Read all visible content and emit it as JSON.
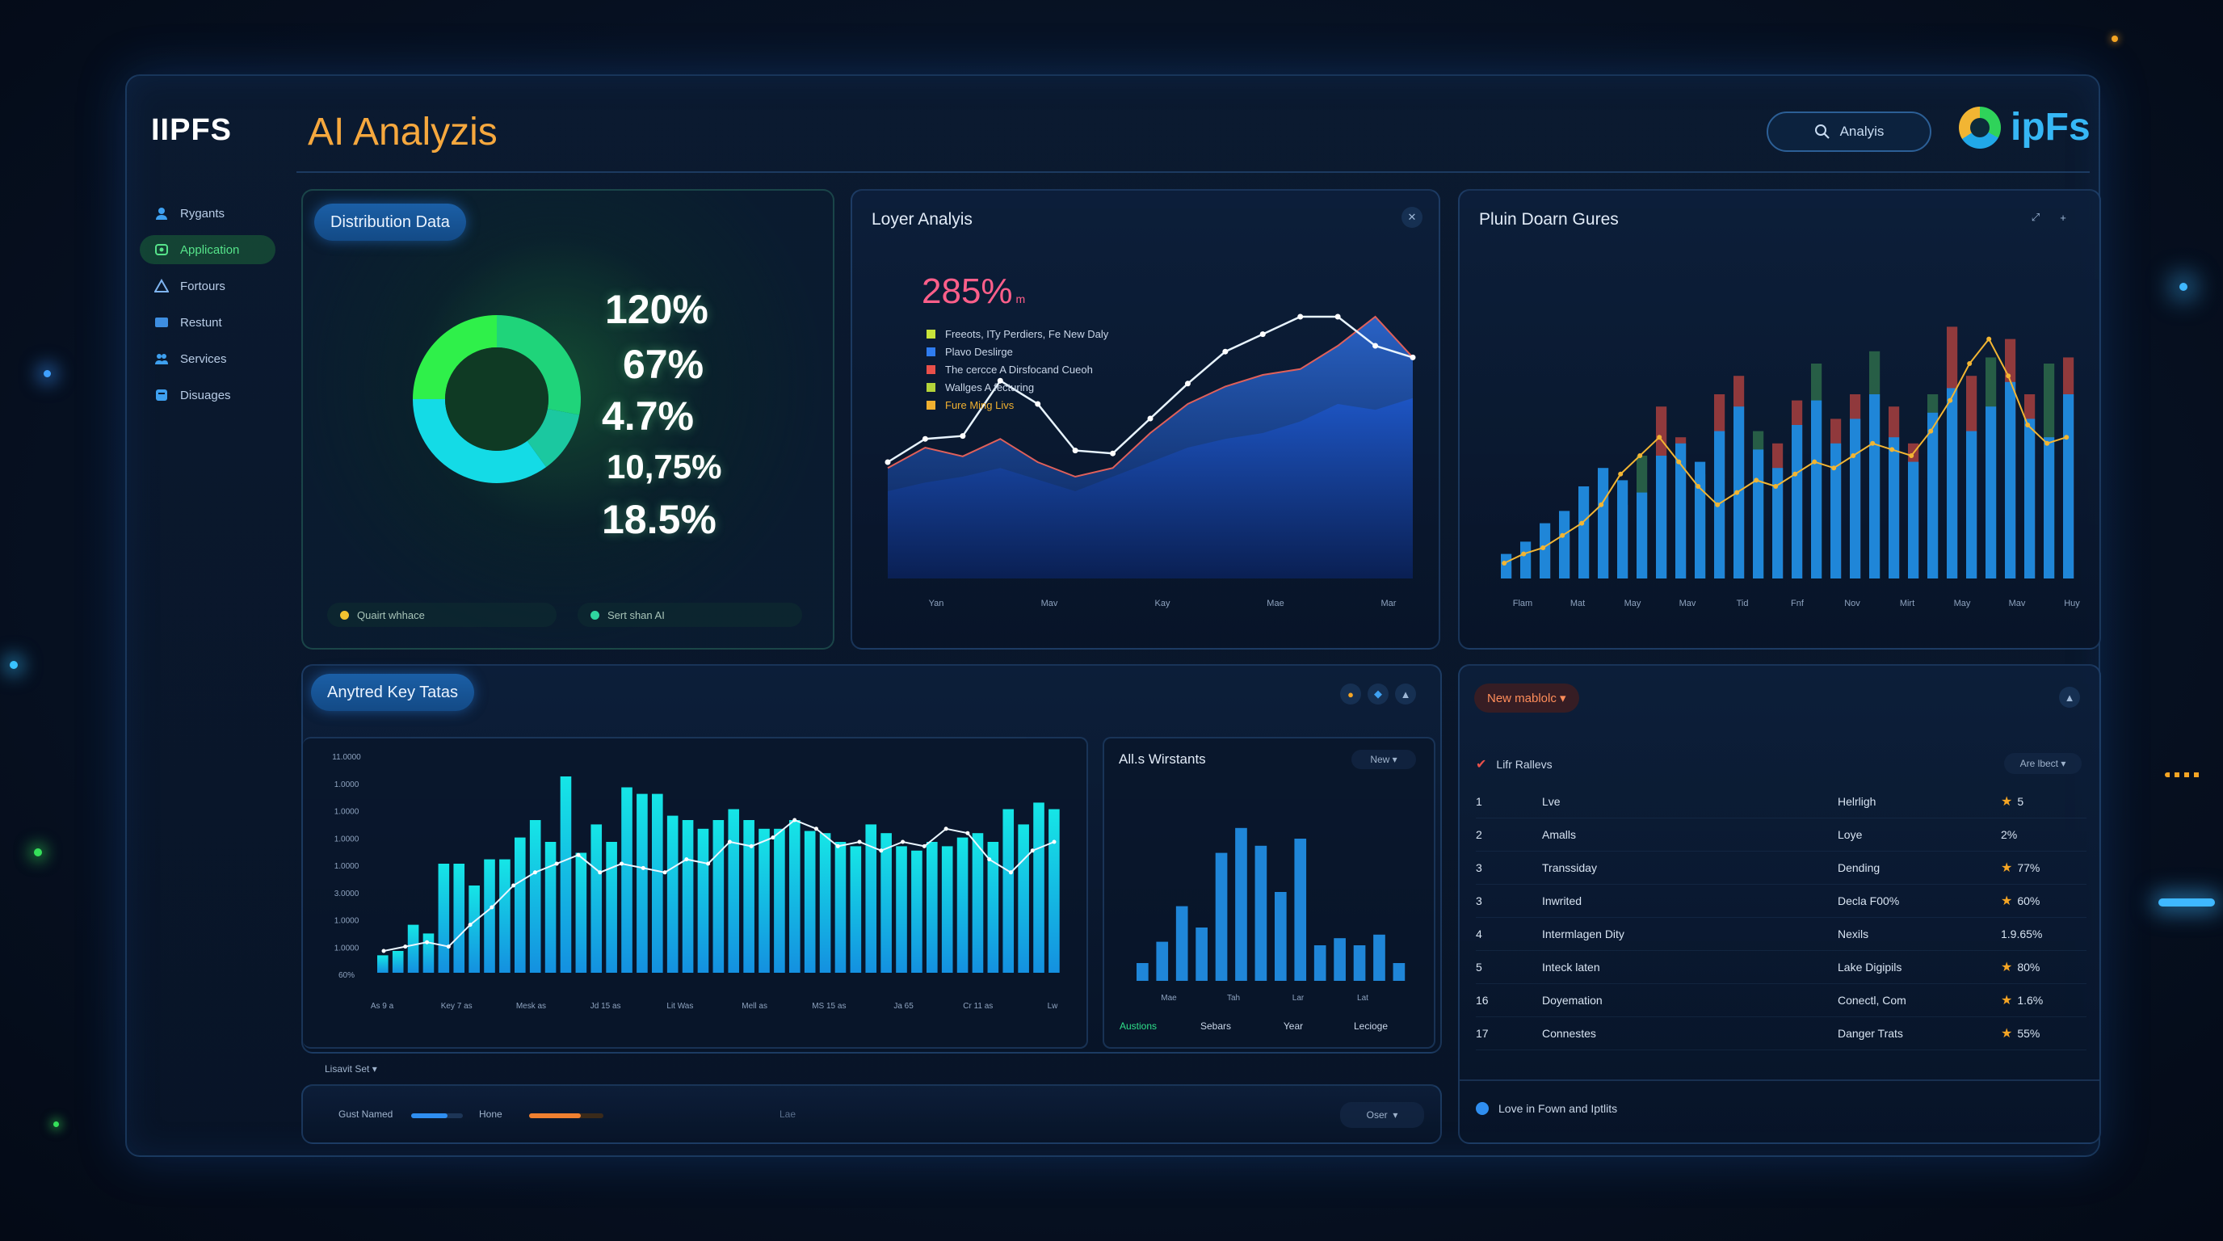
{
  "header": {
    "brand": "IIPFS",
    "title": "AI Analyzis",
    "search_label": "Analyis",
    "logo_text": "ipFs"
  },
  "sidebar": {
    "items": [
      {
        "label": "Rygants",
        "icon": "user-icon",
        "active": false
      },
      {
        "label": "Application",
        "icon": "app-icon",
        "active": true
      },
      {
        "label": "Fortours",
        "icon": "triangle-icon",
        "active": false
      },
      {
        "label": "Restunt",
        "icon": "card-icon",
        "active": false
      },
      {
        "label": "Services",
        "icon": "users-icon",
        "active": false
      },
      {
        "label": "Disuages",
        "icon": "box-icon",
        "active": false
      }
    ]
  },
  "distribution": {
    "title": "Distribution Data",
    "percents": [
      "120%",
      "67%",
      "4.7%",
      "10,75%",
      "18.5%"
    ],
    "legend": [
      {
        "label": "Quairt whhace",
        "color": "#f2c230"
      },
      {
        "label": "Sert shan AI",
        "color": "#2fd6a0"
      }
    ]
  },
  "layer": {
    "title": "Loyer Analyis",
    "highlight": "285%",
    "highlight_unit": "m",
    "legend": [
      {
        "label": "Freeots, ITy Perdiers, Fe New Daly",
        "color": "#c8e33a"
      },
      {
        "label": "Plavo Deslirge",
        "color": "#2f7cf0"
      },
      {
        "label": "The cercce A Dirsfocand Cueoh",
        "color": "#e9504a"
      },
      {
        "label": "Wallges A fecturing",
        "color": "#b4d43a"
      },
      {
        "label": "Fure Ming Livs",
        "color": "#f0b030"
      }
    ],
    "x_labels": [
      "Yan",
      "Mav",
      "Kay",
      "Mae",
      "Mar"
    ]
  },
  "plain": {
    "title": "Pluin Doarn Gures",
    "x_labels": [
      "Flam",
      "Mat",
      "May",
      "Mav",
      "Tid",
      "Fnf",
      "Nov",
      "Mirt",
      "May",
      "Mav",
      "Huy"
    ]
  },
  "keystats": {
    "title": "Anytred Key Tatas",
    "y_labels": [
      "11.0000",
      "1.0000",
      "1.0000",
      "1.0000",
      "1.0000",
      "3.0000",
      "1.0000",
      "1.0000",
      "60%"
    ],
    "x_labels": [
      "As 9 a",
      "Key 7 as",
      "Mesk as",
      "Jd 15 as",
      "Lit Was",
      "Mell as",
      "MS 15 as",
      "Ja 65",
      "Cr 11 as",
      "Lw"
    ],
    "dropdown": "Lisavit Set"
  },
  "allwarrants": {
    "title": "All.s Wirstants",
    "filter": "New",
    "x_labels": [
      "Mae",
      "Tah",
      "Lar",
      "Lat"
    ],
    "tabs": [
      "Austions",
      "Sebars",
      "Year",
      "Lecioge"
    ]
  },
  "bottombar": {
    "label1": "Gust Named",
    "label2": "Hone",
    "label3": "Lae",
    "button": "Oser"
  },
  "table": {
    "dropdown": "New mablolc",
    "header_left": "Lifr Rallevs",
    "header_right": "Are lbect",
    "rows": [
      {
        "n": "1",
        "name": "Lve",
        "cat": "Helrligh",
        "val": "5",
        "star": true
      },
      {
        "n": "2",
        "name": "Amalls",
        "cat": "Loye",
        "val": "2%",
        "star": false
      },
      {
        "n": "3",
        "name": "Transsiday",
        "cat": "Dending",
        "val": "77%",
        "star": true
      },
      {
        "n": "3",
        "name": "Inwrited",
        "cat": "Decla F00%",
        "val": "60%",
        "star": true
      },
      {
        "n": "4",
        "name": "Intermlagen Dity",
        "cat": "Nexils",
        "val": "1.9.65%",
        "star": false
      },
      {
        "n": "5",
        "name": "Inteck laten",
        "cat": "Lake Digipils",
        "val": "80%",
        "star": true
      },
      {
        "n": "16",
        "name": "Doyemation",
        "cat": "Conectl, Com",
        "val": "1.6%",
        "star": true
      },
      {
        "n": "17",
        "name": "Connestes",
        "cat": "Danger Trats",
        "val": "55%",
        "star": true
      }
    ],
    "footer": "Love in Fown and Iptlits"
  },
  "colors": {
    "accent_orange": "#f6a83e",
    "green": "#2fe05a",
    "cyan": "#18e0e0",
    "blue": "#1f7fe0",
    "red": "#c94a44"
  },
  "chart_data": [
    {
      "type": "pie",
      "title": "Distribution Data",
      "values": [
        28,
        12,
        35,
        25
      ],
      "colors": [
        "#1fd47a",
        "#1bc8a0",
        "#14dbe6",
        "#2ff04a"
      ]
    },
    {
      "type": "area",
      "title": "Loyer Analyis",
      "x": [
        "Yan",
        "Mav",
        "Kay",
        "Mae",
        "Mar"
      ],
      "series": [
        {
          "values": [
            40,
            48,
            49,
            68,
            60,
            44,
            43,
            55,
            67,
            78,
            84,
            90,
            90,
            80,
            76
          ]
        },
        {
          "values": [
            38,
            45,
            42,
            48,
            40,
            35,
            38,
            50,
            60,
            66,
            70,
            72,
            80,
            90,
            76
          ]
        },
        {
          "values": [
            30,
            33,
            35,
            38,
            34,
            30,
            35,
            40,
            45,
            48,
            50,
            54,
            60,
            58,
            62
          ]
        }
      ],
      "ylim": [
        0,
        100
      ]
    },
    {
      "type": "bar",
      "title": "Pluin Doarn Gures",
      "categories": [
        "Flam",
        "Mat",
        "May",
        "Mav",
        "Tid",
        "Fnf",
        "Nov",
        "Mirt",
        "May",
        "Mav",
        "Huy"
      ],
      "series": [
        {
          "name": "blue",
          "values": [
            8,
            12,
            18,
            22,
            30,
            36,
            32,
            28,
            40,
            44,
            38,
            48,
            56,
            42,
            36,
            50,
            58,
            44,
            52,
            60,
            46,
            38,
            54,
            62,
            48,
            56,
            64,
            52,
            46,
            60
          ]
        },
        {
          "name": "red",
          "values": [
            4,
            6,
            12,
            14,
            20,
            28,
            24,
            40,
            56,
            46,
            34,
            60,
            66,
            48,
            44,
            58,
            70,
            52,
            60,
            74,
            56,
            44,
            60,
            82,
            66,
            72,
            78,
            60,
            70,
            72
          ]
        },
        {
          "name": "line",
          "values": [
            5,
            8,
            10,
            14,
            18,
            24,
            34,
            40,
            46,
            38,
            30,
            24,
            28,
            32,
            30,
            34,
            38,
            36,
            40,
            44,
            42,
            40,
            48,
            58,
            70,
            78,
            66,
            50,
            44,
            46
          ]
        }
      ],
      "ylim": [
        0,
        100
      ]
    },
    {
      "type": "bar",
      "title": "Anytred Key Tatas",
      "series": [
        {
          "name": "bars",
          "values": [
            8,
            10,
            22,
            18,
            50,
            50,
            40,
            52,
            52,
            62,
            70,
            60,
            90,
            55,
            68,
            60,
            85,
            82,
            82,
            72,
            70,
            66,
            70,
            75,
            70,
            66,
            66,
            70,
            65,
            64,
            60,
            58,
            68,
            64,
            58,
            56,
            60,
            58,
            62,
            64,
            60,
            75,
            68,
            78,
            75
          ]
        },
        {
          "name": "line",
          "values": [
            10,
            12,
            14,
            12,
            22,
            30,
            40,
            46,
            50,
            54,
            46,
            50,
            48,
            46,
            52,
            50,
            60,
            58,
            62,
            70,
            66,
            58,
            60,
            56,
            60,
            58,
            66,
            64,
            52,
            46,
            56,
            60
          ]
        }
      ],
      "ylim": [
        0,
        100
      ]
    },
    {
      "type": "bar",
      "title": "All.s Wirstants",
      "categories": [
        "Mae",
        "Tah",
        "Lar",
        "Lat"
      ],
      "values": [
        10,
        22,
        42,
        30,
        72,
        86,
        76,
        50,
        80,
        20,
        24,
        20,
        26,
        10
      ],
      "ylim": [
        0,
        100
      ]
    }
  ]
}
